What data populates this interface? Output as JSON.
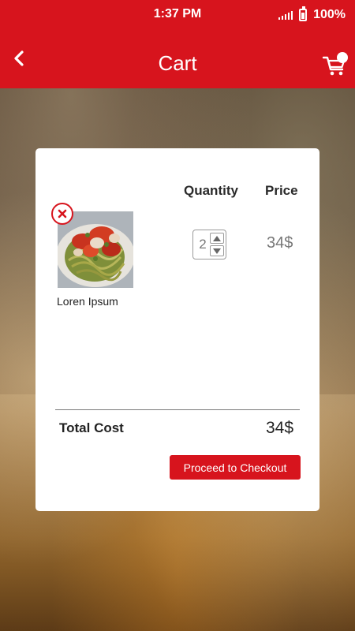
{
  "status_bar": {
    "time": "1:37 PM",
    "battery_text": "100%",
    "icons": [
      "signal-icon",
      "battery-icon"
    ]
  },
  "header": {
    "title": "Cart",
    "back_icon": "chevron-left-icon",
    "cart_icon": "shopping-cart-icon"
  },
  "cart": {
    "columns": {
      "quantity": "Quantity",
      "price": "Price"
    },
    "items": [
      {
        "name": "Loren Ipsum",
        "quantity": "2",
        "price": "34$",
        "remove_icon": "close-icon",
        "image": "pasta-dish-photo"
      }
    ],
    "total_label": "Total Cost",
    "total_value": "34$",
    "checkout_label": "Proceed to Checkout"
  },
  "colors": {
    "primary": "#d7141d",
    "card": "#ffffff",
    "text_dark": "#222222",
    "text_muted": "#777777"
  }
}
